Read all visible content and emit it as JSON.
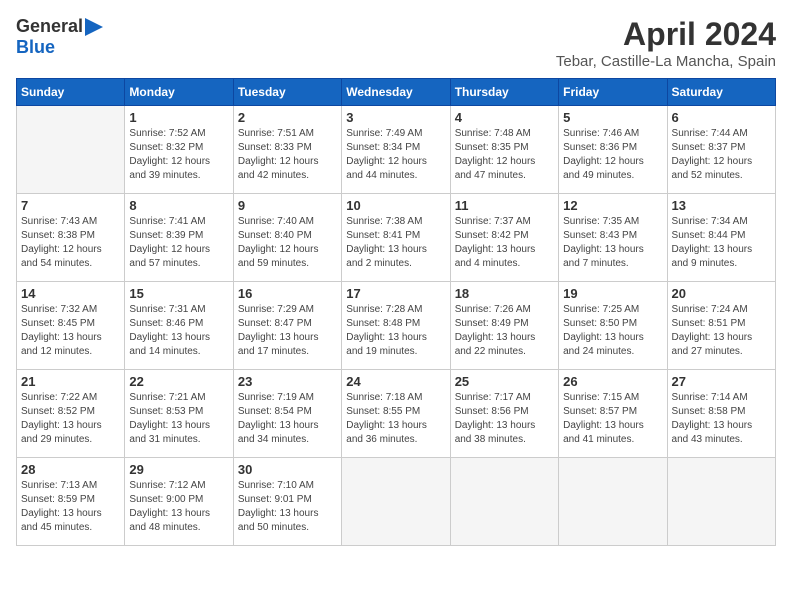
{
  "logo": {
    "general": "General",
    "blue": "Blue"
  },
  "header": {
    "month": "April 2024",
    "location": "Tebar, Castille-La Mancha, Spain"
  },
  "weekdays": [
    "Sunday",
    "Monday",
    "Tuesday",
    "Wednesday",
    "Thursday",
    "Friday",
    "Saturday"
  ],
  "weeks": [
    [
      {
        "day": "",
        "sunrise": "",
        "sunset": "",
        "daylight": ""
      },
      {
        "day": "1",
        "sunrise": "Sunrise: 7:52 AM",
        "sunset": "Sunset: 8:32 PM",
        "daylight": "Daylight: 12 hours and 39 minutes."
      },
      {
        "day": "2",
        "sunrise": "Sunrise: 7:51 AM",
        "sunset": "Sunset: 8:33 PM",
        "daylight": "Daylight: 12 hours and 42 minutes."
      },
      {
        "day": "3",
        "sunrise": "Sunrise: 7:49 AM",
        "sunset": "Sunset: 8:34 PM",
        "daylight": "Daylight: 12 hours and 44 minutes."
      },
      {
        "day": "4",
        "sunrise": "Sunrise: 7:48 AM",
        "sunset": "Sunset: 8:35 PM",
        "daylight": "Daylight: 12 hours and 47 minutes."
      },
      {
        "day": "5",
        "sunrise": "Sunrise: 7:46 AM",
        "sunset": "Sunset: 8:36 PM",
        "daylight": "Daylight: 12 hours and 49 minutes."
      },
      {
        "day": "6",
        "sunrise": "Sunrise: 7:44 AM",
        "sunset": "Sunset: 8:37 PM",
        "daylight": "Daylight: 12 hours and 52 minutes."
      }
    ],
    [
      {
        "day": "7",
        "sunrise": "Sunrise: 7:43 AM",
        "sunset": "Sunset: 8:38 PM",
        "daylight": "Daylight: 12 hours and 54 minutes."
      },
      {
        "day": "8",
        "sunrise": "Sunrise: 7:41 AM",
        "sunset": "Sunset: 8:39 PM",
        "daylight": "Daylight: 12 hours and 57 minutes."
      },
      {
        "day": "9",
        "sunrise": "Sunrise: 7:40 AM",
        "sunset": "Sunset: 8:40 PM",
        "daylight": "Daylight: 12 hours and 59 minutes."
      },
      {
        "day": "10",
        "sunrise": "Sunrise: 7:38 AM",
        "sunset": "Sunset: 8:41 PM",
        "daylight": "Daylight: 13 hours and 2 minutes."
      },
      {
        "day": "11",
        "sunrise": "Sunrise: 7:37 AM",
        "sunset": "Sunset: 8:42 PM",
        "daylight": "Daylight: 13 hours and 4 minutes."
      },
      {
        "day": "12",
        "sunrise": "Sunrise: 7:35 AM",
        "sunset": "Sunset: 8:43 PM",
        "daylight": "Daylight: 13 hours and 7 minutes."
      },
      {
        "day": "13",
        "sunrise": "Sunrise: 7:34 AM",
        "sunset": "Sunset: 8:44 PM",
        "daylight": "Daylight: 13 hours and 9 minutes."
      }
    ],
    [
      {
        "day": "14",
        "sunrise": "Sunrise: 7:32 AM",
        "sunset": "Sunset: 8:45 PM",
        "daylight": "Daylight: 13 hours and 12 minutes."
      },
      {
        "day": "15",
        "sunrise": "Sunrise: 7:31 AM",
        "sunset": "Sunset: 8:46 PM",
        "daylight": "Daylight: 13 hours and 14 minutes."
      },
      {
        "day": "16",
        "sunrise": "Sunrise: 7:29 AM",
        "sunset": "Sunset: 8:47 PM",
        "daylight": "Daylight: 13 hours and 17 minutes."
      },
      {
        "day": "17",
        "sunrise": "Sunrise: 7:28 AM",
        "sunset": "Sunset: 8:48 PM",
        "daylight": "Daylight: 13 hours and 19 minutes."
      },
      {
        "day": "18",
        "sunrise": "Sunrise: 7:26 AM",
        "sunset": "Sunset: 8:49 PM",
        "daylight": "Daylight: 13 hours and 22 minutes."
      },
      {
        "day": "19",
        "sunrise": "Sunrise: 7:25 AM",
        "sunset": "Sunset: 8:50 PM",
        "daylight": "Daylight: 13 hours and 24 minutes."
      },
      {
        "day": "20",
        "sunrise": "Sunrise: 7:24 AM",
        "sunset": "Sunset: 8:51 PM",
        "daylight": "Daylight: 13 hours and 27 minutes."
      }
    ],
    [
      {
        "day": "21",
        "sunrise": "Sunrise: 7:22 AM",
        "sunset": "Sunset: 8:52 PM",
        "daylight": "Daylight: 13 hours and 29 minutes."
      },
      {
        "day": "22",
        "sunrise": "Sunrise: 7:21 AM",
        "sunset": "Sunset: 8:53 PM",
        "daylight": "Daylight: 13 hours and 31 minutes."
      },
      {
        "day": "23",
        "sunrise": "Sunrise: 7:19 AM",
        "sunset": "Sunset: 8:54 PM",
        "daylight": "Daylight: 13 hours and 34 minutes."
      },
      {
        "day": "24",
        "sunrise": "Sunrise: 7:18 AM",
        "sunset": "Sunset: 8:55 PM",
        "daylight": "Daylight: 13 hours and 36 minutes."
      },
      {
        "day": "25",
        "sunrise": "Sunrise: 7:17 AM",
        "sunset": "Sunset: 8:56 PM",
        "daylight": "Daylight: 13 hours and 38 minutes."
      },
      {
        "day": "26",
        "sunrise": "Sunrise: 7:15 AM",
        "sunset": "Sunset: 8:57 PM",
        "daylight": "Daylight: 13 hours and 41 minutes."
      },
      {
        "day": "27",
        "sunrise": "Sunrise: 7:14 AM",
        "sunset": "Sunset: 8:58 PM",
        "daylight": "Daylight: 13 hours and 43 minutes."
      }
    ],
    [
      {
        "day": "28",
        "sunrise": "Sunrise: 7:13 AM",
        "sunset": "Sunset: 8:59 PM",
        "daylight": "Daylight: 13 hours and 45 minutes."
      },
      {
        "day": "29",
        "sunrise": "Sunrise: 7:12 AM",
        "sunset": "Sunset: 9:00 PM",
        "daylight": "Daylight: 13 hours and 48 minutes."
      },
      {
        "day": "30",
        "sunrise": "Sunrise: 7:10 AM",
        "sunset": "Sunset: 9:01 PM",
        "daylight": "Daylight: 13 hours and 50 minutes."
      },
      {
        "day": "",
        "sunrise": "",
        "sunset": "",
        "daylight": ""
      },
      {
        "day": "",
        "sunrise": "",
        "sunset": "",
        "daylight": ""
      },
      {
        "day": "",
        "sunrise": "",
        "sunset": "",
        "daylight": ""
      },
      {
        "day": "",
        "sunrise": "",
        "sunset": "",
        "daylight": ""
      }
    ]
  ]
}
